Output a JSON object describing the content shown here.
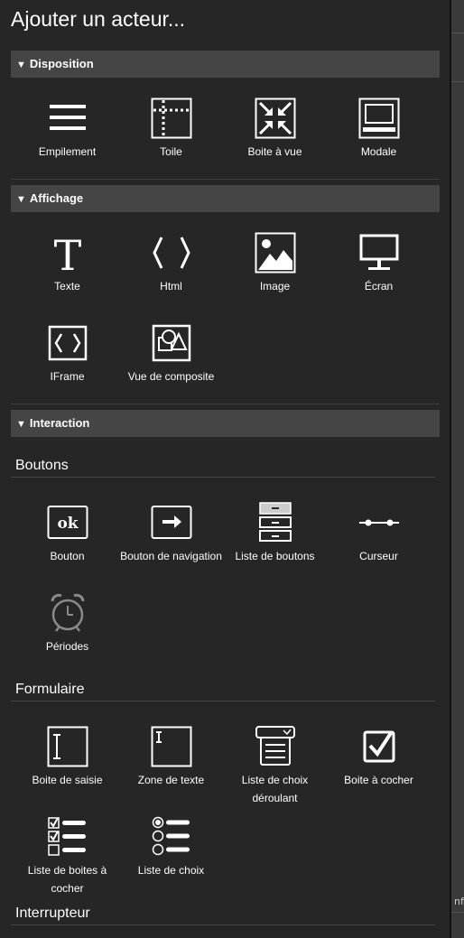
{
  "title": "Ajouter un acteur...",
  "sections": {
    "disposition": {
      "label": "Disposition",
      "items": [
        {
          "label": "Empilement",
          "icon": "stack-icon"
        },
        {
          "label": "Toile",
          "icon": "canvas-icon"
        },
        {
          "label": "Boite à vue",
          "icon": "viewbox-icon"
        },
        {
          "label": "Modale",
          "icon": "modal-icon"
        }
      ]
    },
    "affichage": {
      "label": "Affichage",
      "items": [
        {
          "label": "Texte",
          "icon": "text-icon"
        },
        {
          "label": "Html",
          "icon": "html-icon"
        },
        {
          "label": "Image",
          "icon": "image-icon"
        },
        {
          "label": "Écran",
          "icon": "screen-icon"
        },
        {
          "label": "IFrame",
          "icon": "iframe-icon"
        },
        {
          "label": "Vue de composite",
          "icon": "composite-view-icon"
        }
      ]
    },
    "interaction": {
      "label": "Interaction",
      "boutons": {
        "label": "Boutons",
        "items": [
          {
            "label": "Bouton",
            "icon": "ok-button-icon"
          },
          {
            "label": "Bouton de navigation",
            "icon": "navigation-button-icon"
          },
          {
            "label": "Liste de boutons",
            "icon": "button-list-icon"
          },
          {
            "label": "Curseur",
            "icon": "slider-icon"
          },
          {
            "label": "Périodes",
            "icon": "alarm-clock-icon"
          }
        ]
      },
      "formulaire": {
        "label": "Formulaire",
        "items": [
          {
            "label": "Boite de saisie",
            "icon": "input-box-icon"
          },
          {
            "label": "Zone de texte",
            "icon": "textarea-icon"
          },
          {
            "label": "Liste de choix déroulant",
            "icon": "dropdown-list-icon"
          },
          {
            "label": "Boite à cocher",
            "icon": "checkbox-icon"
          },
          {
            "label": "Liste de boites à cocher",
            "icon": "checkbox-list-icon"
          },
          {
            "label": "Liste de choix",
            "icon": "radio-list-icon"
          }
        ]
      },
      "interrupteur": {
        "label": "Interrupteur"
      }
    }
  },
  "background": {
    "fragment": "nfi"
  },
  "colors": {
    "panel": "#262626",
    "header": "#454545",
    "text": "#ffffff"
  }
}
